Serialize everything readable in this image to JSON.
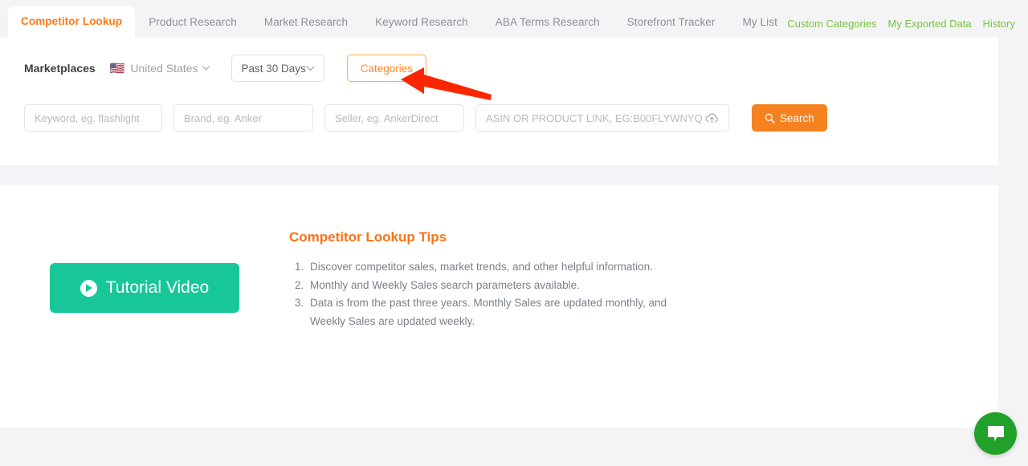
{
  "nav": {
    "tabs": [
      {
        "label": "Competitor Lookup",
        "active": true
      },
      {
        "label": "Product Research",
        "active": false
      },
      {
        "label": "Market Research",
        "active": false
      },
      {
        "label": "Keyword Research",
        "active": false
      },
      {
        "label": "ABA Terms Research",
        "active": false
      },
      {
        "label": "Storefront Tracker",
        "active": false
      },
      {
        "label": "My List",
        "active": false
      }
    ],
    "links": [
      {
        "label": "Custom Categories"
      },
      {
        "label": "My Exported Data"
      },
      {
        "label": "History"
      }
    ],
    "active_tab_color": "#ff7a18",
    "link_color": "#7ac143"
  },
  "filters": {
    "marketplaces_label": "Marketplaces",
    "country": "United States",
    "country_flag": "🇺🇸",
    "date_range": "Past 30 Days",
    "categories_button": "Categories"
  },
  "search": {
    "keyword_placeholder": "Keyword, eg. flashlight",
    "keyword_value": "",
    "brand_placeholder": "Brand, eg. Anker",
    "brand_value": "",
    "seller_placeholder": "Seller, eg. AnkerDirect",
    "seller_value": "",
    "asin_placeholder": "ASIN OR PRODUCT LINK, EG:B00FLYWNYQ",
    "asin_value": "",
    "upload_icon": "cloud-upload-icon",
    "search_button": "Search",
    "search_icon": "search-icon",
    "search_button_color": "#f58220"
  },
  "content": {
    "video_button": "Tutorial Video",
    "video_icon": "play-icon",
    "video_button_color": "#17c79a",
    "tips_title": "Competitor Lookup Tips",
    "tips_title_color": "#f97316",
    "tips": [
      "Discover competitor sales, market trends, and other helpful information.",
      "Monthly and Weekly Sales search parameters available.",
      "Data is from the past three years. Monthly Sales are updated monthly, and Weekly Sales are updated weekly."
    ]
  },
  "annotation": {
    "arrow_color": "#fa2600",
    "points_to": "Categories"
  },
  "chat": {
    "icon": "chat-bubble-icon",
    "color": "#22a12a"
  }
}
